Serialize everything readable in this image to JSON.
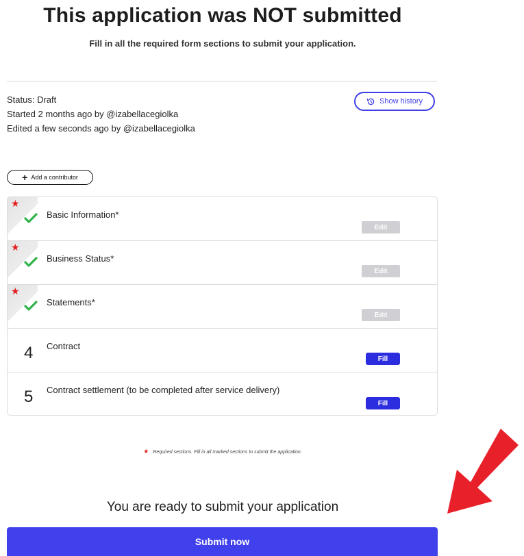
{
  "header": {
    "title": "This application was NOT submitted",
    "subtitle": "Fill in all the required form sections to submit your application."
  },
  "status": {
    "status_text": "Status: Draft",
    "started_text": "Started 2 months ago by @izabellacegiolka",
    "edited_text": "Edited a few seconds ago by @izabellacegiolka",
    "show_history_label": "Show history"
  },
  "add_contributor_label": "Add a contributor",
  "sections": [
    {
      "label": "Basic Information*",
      "required": true,
      "completed": true,
      "action": "Edit"
    },
    {
      "label": "Business Status*",
      "required": true,
      "completed": true,
      "action": "Edit"
    },
    {
      "label": "Statements*",
      "required": true,
      "completed": true,
      "action": "Edit"
    },
    {
      "number": "4",
      "label": "Contract",
      "required": false,
      "completed": false,
      "action": "Fill"
    },
    {
      "number": "5",
      "label": "Contract settlement (to be completed after service delivery)",
      "required": false,
      "completed": false,
      "action": "Fill"
    }
  ],
  "required_note": "Required sections. Fill in all marked sections to submit the application.",
  "ready_text": "You are ready to submit your application",
  "submit_label": "Submit now",
  "icons": {
    "history": "history-icon",
    "plus": "plus-icon",
    "check": "checkmark-icon",
    "star": "required-star-icon",
    "arrow": "red-arrow-icon"
  },
  "colors": {
    "accent": "#3f3fe8",
    "submit": "#4040ec",
    "fill_button": "#2d2de0",
    "edit_button_disabled": "#d0d0d4",
    "required_star": "#e21c1c",
    "check": "#2fb34a",
    "arrow": "#e8202a"
  }
}
